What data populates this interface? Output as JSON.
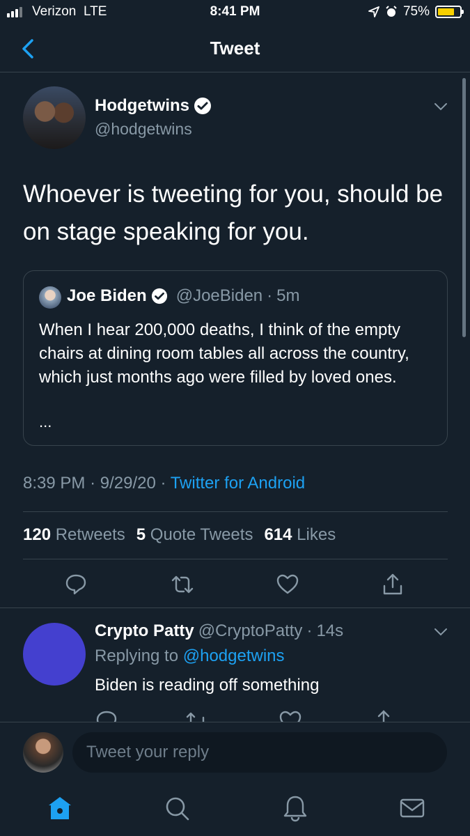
{
  "status_bar": {
    "carrier": "Verizon",
    "network": "LTE",
    "time": "8:41 PM",
    "battery": "75%",
    "battery_level": 0.75
  },
  "header": {
    "title": "Tweet",
    "back_icon": "chevron-left-icon"
  },
  "tweet": {
    "author_name": "Hodgetwins",
    "author_handle": "@hodgetwins",
    "verified": true,
    "text": "Whoever is tweeting for you, should be on stage speaking for you.",
    "quote": {
      "name": "Joe Biden",
      "handle": "@JoeBiden",
      "time": "5m",
      "text": "When I hear 200,000 deaths, I think of the empty chairs at dining room tables all across the country, which just months ago were filled by loved ones.",
      "ellipsis": "..."
    },
    "time": "8:39 PM",
    "date": "9/29/20",
    "source": "Twitter for Android",
    "stats": {
      "retweets_count": "120",
      "retweets_label": "Retweets",
      "quotes_count": "5",
      "quotes_label": "Quote Tweets",
      "likes_count": "614",
      "likes_label": "Likes"
    }
  },
  "reply": {
    "name": "Crypto Patty",
    "handle": "@CryptoPatty",
    "time": "14s",
    "replying_label": "Replying to",
    "replying_to": "@hodgetwins",
    "text": "Biden is reading off something"
  },
  "composer": {
    "placeholder": "Tweet your reply"
  },
  "colors": {
    "background": "#15202b",
    "accent": "#1da1f2",
    "muted": "#8899a6",
    "border": "#38444d"
  },
  "nav": [
    "home-icon",
    "search-icon",
    "notifications-icon",
    "messages-icon"
  ]
}
